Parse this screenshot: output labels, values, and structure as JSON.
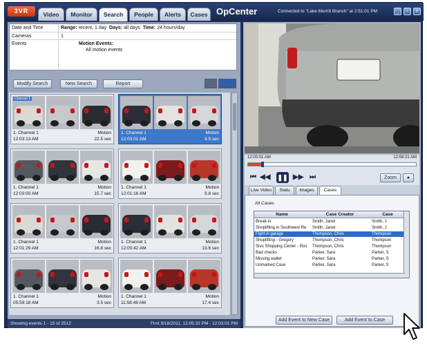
{
  "app": {
    "logo": "3VR",
    "title": "OpCenter",
    "connection_status": "Connected to \"Lake Merritt Branch\" at 2:51:01 PM",
    "window_buttons": [
      "minimize-icon",
      "restore-icon",
      "close-icon"
    ]
  },
  "nav": {
    "tabs": [
      {
        "label": "Video",
        "active": false
      },
      {
        "label": "Monitor",
        "active": false
      },
      {
        "label": "Search",
        "active": true
      },
      {
        "label": "People",
        "active": false
      },
      {
        "label": "Alerts",
        "active": false
      },
      {
        "label": "Cases",
        "active": false
      }
    ]
  },
  "criteria": {
    "date_label": "Date and Time",
    "range_key": "Range:",
    "range_val": "recent, 1 day",
    "days_key": "Days:",
    "days_val": "all days",
    "time_key": "Time:",
    "time_val": "24 hours/day",
    "cameras_label": "Cameras",
    "cameras_val": "1",
    "events_label": "Events",
    "events_title": "Motion Events:",
    "events_val": "All motion events"
  },
  "toolbar": {
    "modify_label": "Modify Search",
    "new_label": "New Search",
    "report_label": "Report"
  },
  "results": [
    {
      "channel": "1. Channel 1",
      "time": "12:03:13 AM",
      "type": "Motion",
      "duration": "22.5 sec",
      "selected": false,
      "tag": "Channel 1"
    },
    {
      "channel": "1. Channel 1",
      "time": "12:03:01 AM",
      "type": "Motion",
      "duration": "4.5 sec",
      "selected": true,
      "tag": ""
    },
    {
      "channel": "1. Channel 1",
      "time": "12:03:00 AM",
      "type": "Motion",
      "duration": "15.7 sec",
      "selected": false,
      "tag": ""
    },
    {
      "channel": "1. Channel 1",
      "time": "12:01:16 AM",
      "type": "Motion",
      "duration": "9.8 sec",
      "selected": false,
      "tag": ""
    },
    {
      "channel": "1. Channel 1",
      "time": "12:01:29 AM",
      "type": "Motion",
      "duration": "16.8 sec",
      "selected": false,
      "tag": ""
    },
    {
      "channel": "1. Channel 1",
      "time": "12:00:42 AM",
      "type": "Motion",
      "duration": "13.6 sec",
      "selected": false,
      "tag": ""
    },
    {
      "channel": "1. Channel 1",
      "time": "05:59:18 AM",
      "type": "Motion",
      "duration": "3.5 sec",
      "selected": false,
      "tag": ""
    },
    {
      "channel": "1. Channel 1",
      "time": "11:58:48 AM",
      "type": "Motion",
      "duration": "17.4 sec",
      "selected": false,
      "tag": ""
    }
  ],
  "statusbar": {
    "left": "Showing events 1 - 15 of 2512",
    "right": "First 9/18/2011, 12:05:32 PM - 12:03:01 PM"
  },
  "player": {
    "time_start": "12:00:01 AM",
    "time_end": "12:59:31 AM",
    "progress": 0.08,
    "controls": [
      "rewind-fast-icon",
      "step-back-icon",
      "pause-icon",
      "step-forward-icon",
      "forward-fast-icon"
    ],
    "zoom_label": "Zoom",
    "subtabs": [
      {
        "label": "Live Video",
        "active": false
      },
      {
        "label": "Statu",
        "active": false
      },
      {
        "label": "Images",
        "active": false
      },
      {
        "label": "Cases",
        "active": true
      }
    ]
  },
  "cases": {
    "header": "All Cases",
    "columns": [
      "Name",
      "Case Creator",
      "Case"
    ],
    "rows": [
      {
        "name": "Break-in",
        "creator": "Smith, Janet",
        "c3": "Smith, J"
      },
      {
        "name": "Shoplifting in Southwest Re",
        "creator": "Smith, Janet",
        "c3": "Smith, J"
      },
      {
        "name": "Fight in garage",
        "creator": "Thompson, Chris",
        "c3": "Thompson",
        "selected": true
      },
      {
        "name": "Shoplifting - Gregory",
        "creator": "Thompson, Chris",
        "c3": "Thompson"
      },
      {
        "name": "Sivo Shopping Center - Ros",
        "creator": "Thompson, Chris",
        "c3": "Thompson"
      },
      {
        "name": "Bad checks",
        "creator": "Parker, Sara",
        "c3": "Parker, S"
      },
      {
        "name": "Missing wallet",
        "creator": "Parker, Sara",
        "c3": "Parker, S"
      },
      {
        "name": "Unmarked Case",
        "creator": "Parker, Sara",
        "c3": "Parker, S"
      }
    ],
    "add_new_label": "Add Event to New Case",
    "add_label": "Add Event to Case"
  }
}
